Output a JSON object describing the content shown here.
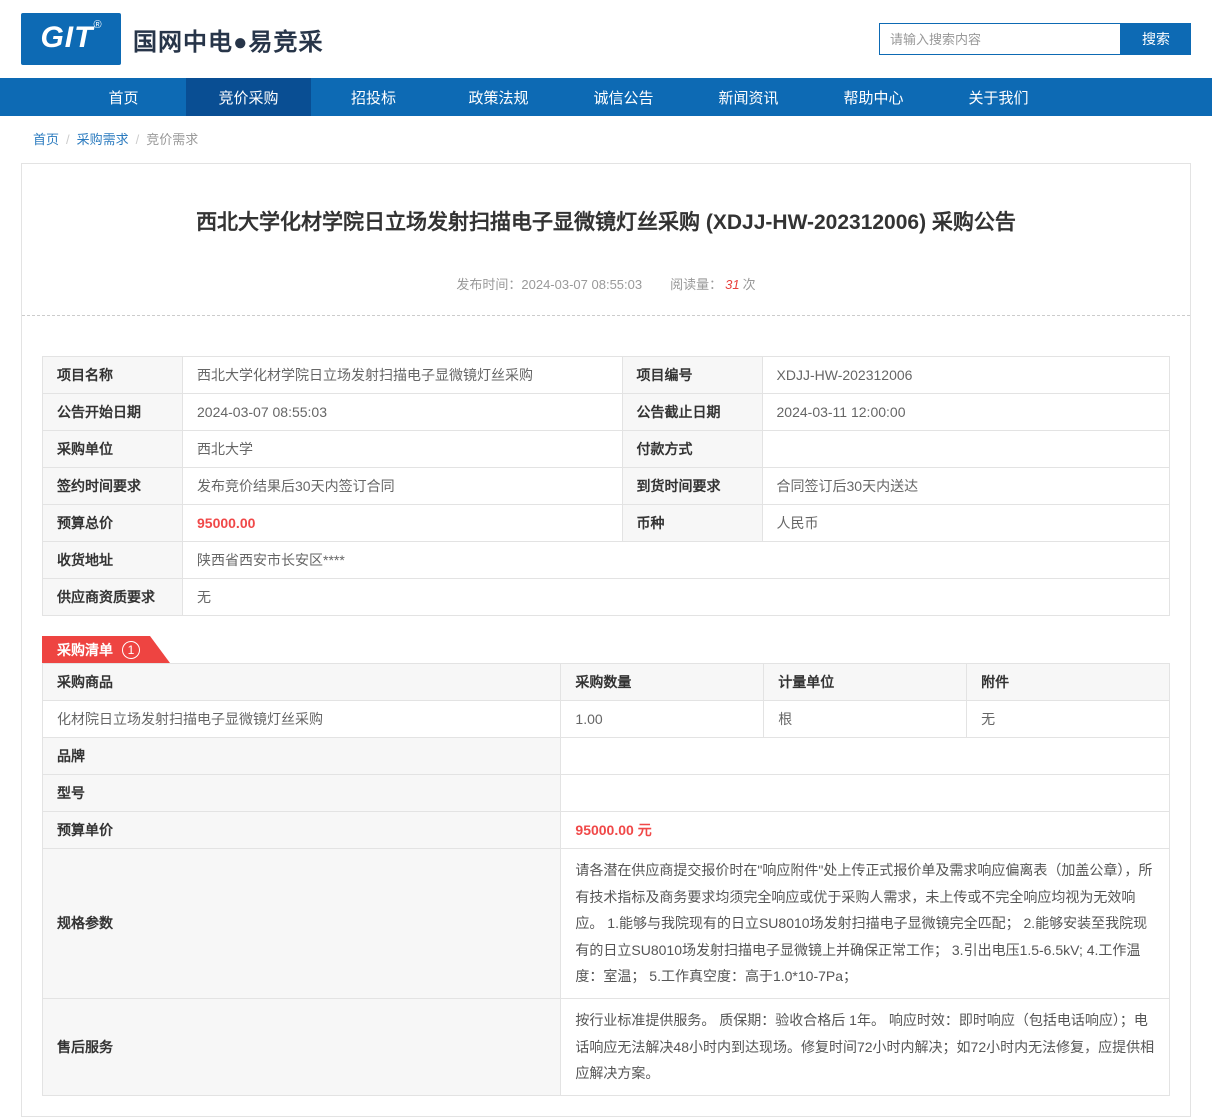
{
  "colors": {
    "brand_blue": "#0d6ab4",
    "nav_active_blue": "#094e93",
    "tab_red": "#ee4441",
    "price_red": "#f04848",
    "link_blue": "#2b7bbf"
  },
  "header": {
    "logo_text": "GIT",
    "logo_reg": "®",
    "brand": "国网中电●易竞采",
    "search_placeholder": "请输入搜索内容",
    "search_button": "搜索"
  },
  "nav": {
    "items": [
      {
        "label": "首页"
      },
      {
        "label": "竞价采购",
        "active": true
      },
      {
        "label": "招投标"
      },
      {
        "label": "政策法规"
      },
      {
        "label": "诚信公告"
      },
      {
        "label": "新闻资讯"
      },
      {
        "label": "帮助中心"
      },
      {
        "label": "关于我们"
      }
    ]
  },
  "breadcrumb": {
    "items": [
      "首页",
      "采购需求",
      "竞价需求"
    ],
    "separator": "/"
  },
  "notice": {
    "title": "西北大学化材学院日立场发射扫描电子显微镜灯丝采购 (XDJJ-HW-202312006) 采购公告",
    "publish_label": "发布时间：",
    "publish_time": "2024-03-07 08:55:03",
    "views_label": "阅读量：",
    "views": "31",
    "views_unit": "次"
  },
  "info_table": {
    "rows": [
      {
        "l1": "项目名称",
        "v1": "西北大学化材学院日立场发射扫描电子显微镜灯丝采购",
        "l2": "项目编号",
        "v2": "XDJJ-HW-202312006"
      },
      {
        "l1": "公告开始日期",
        "v1": "2024-03-07 08:55:03",
        "l2": "公告截止日期",
        "v2": "2024-03-11 12:00:00"
      },
      {
        "l1": "采购单位",
        "v1": "西北大学",
        "l2": "付款方式",
        "v2": ""
      },
      {
        "l1": "签约时间要求",
        "v1": "发布竞价结果后30天内签订合同",
        "l2": "到货时间要求",
        "v2": "合同签订后30天内送达"
      },
      {
        "l1": "预算总价",
        "v1": "95000.00",
        "l2": "币种",
        "v2": "人民币"
      },
      {
        "l1": "收货地址",
        "v1": "陕西省西安市长安区****"
      },
      {
        "l1": "供应商资质要求",
        "v1": "无"
      }
    ]
  },
  "purchase_list": {
    "tab_label": "采购清单",
    "badge": "1",
    "headers": [
      "采购商品",
      "采购数量",
      "计量单位",
      "附件"
    ],
    "item": {
      "name": "化材院日立场发射扫描电子显微镜灯丝采购",
      "qty": "1.00",
      "unit": "根",
      "attachment": "无"
    },
    "details": [
      {
        "label": "品牌",
        "value": ""
      },
      {
        "label": "型号",
        "value": ""
      },
      {
        "label": "预算单价",
        "value": "95000.00 元"
      },
      {
        "label": "规格参数",
        "value": "请各潜在供应商提交报价时在\"响应附件\"处上传正式报价单及需求响应偏离表（加盖公章），所有技术指标及商务要求均须完全响应或优于采购人需求，未上传或不完全响应均视为无效响应。 1.能够与我院现有的日立SU8010场发射扫描电子显微镜完全匹配； 2.能够安装至我院现有的日立SU8010场发射扫描电子显微镜上并确保正常工作； 3.引出电压1.5-6.5kV; 4.工作温度：室温； 5.工作真空度：高于1.0*10-7Pa；"
      },
      {
        "label": "售后服务",
        "value": "按行业标准提供服务。 质保期：验收合格后 1年。 响应时效：即时响应（包括电话响应）；电话响应无法解决48小时内到达现场。修复时间72小时内解决；如72小时内无法修复，应提供相应解决方案。"
      }
    ]
  }
}
